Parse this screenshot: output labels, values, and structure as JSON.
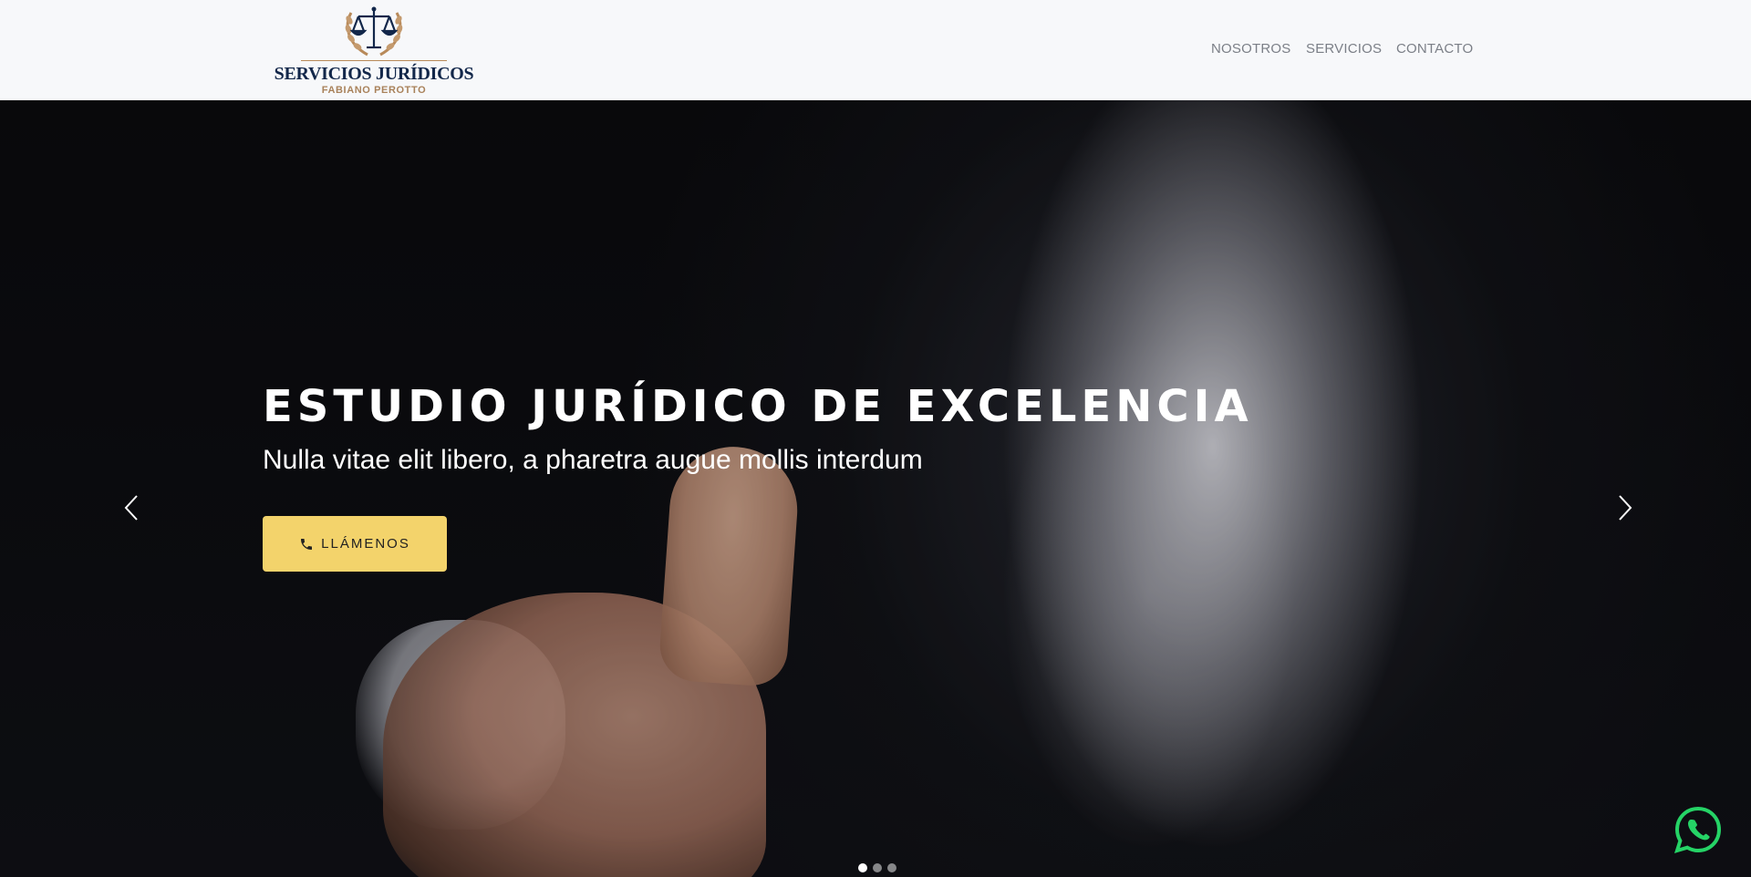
{
  "brand": {
    "title": "SERVICIOS JURÍDICOS",
    "subtitle": "FABIANO PEROTTO"
  },
  "nav": {
    "items": [
      {
        "label": "NOSOTROS"
      },
      {
        "label": "SERVICIOS"
      },
      {
        "label": "CONTACTO"
      }
    ]
  },
  "hero": {
    "title": "ESTUDIO JURÍDICO DE EXCELENCIA",
    "subtitle": "Nulla vitae elit libero, a pharetra augue mollis interdum",
    "cta_label": "LLÁMENOS",
    "cta_icon": "phone-icon",
    "slides_total": 3,
    "active_slide": 1
  },
  "colors": {
    "accent": "#f3d36b",
    "brand_navy": "#12274a",
    "brand_gold": "#b88a5a",
    "whatsapp": "#25d366"
  },
  "icons": {
    "prev": "chevron-left-icon",
    "next": "chevron-right-icon",
    "floating": "whatsapp-icon"
  }
}
